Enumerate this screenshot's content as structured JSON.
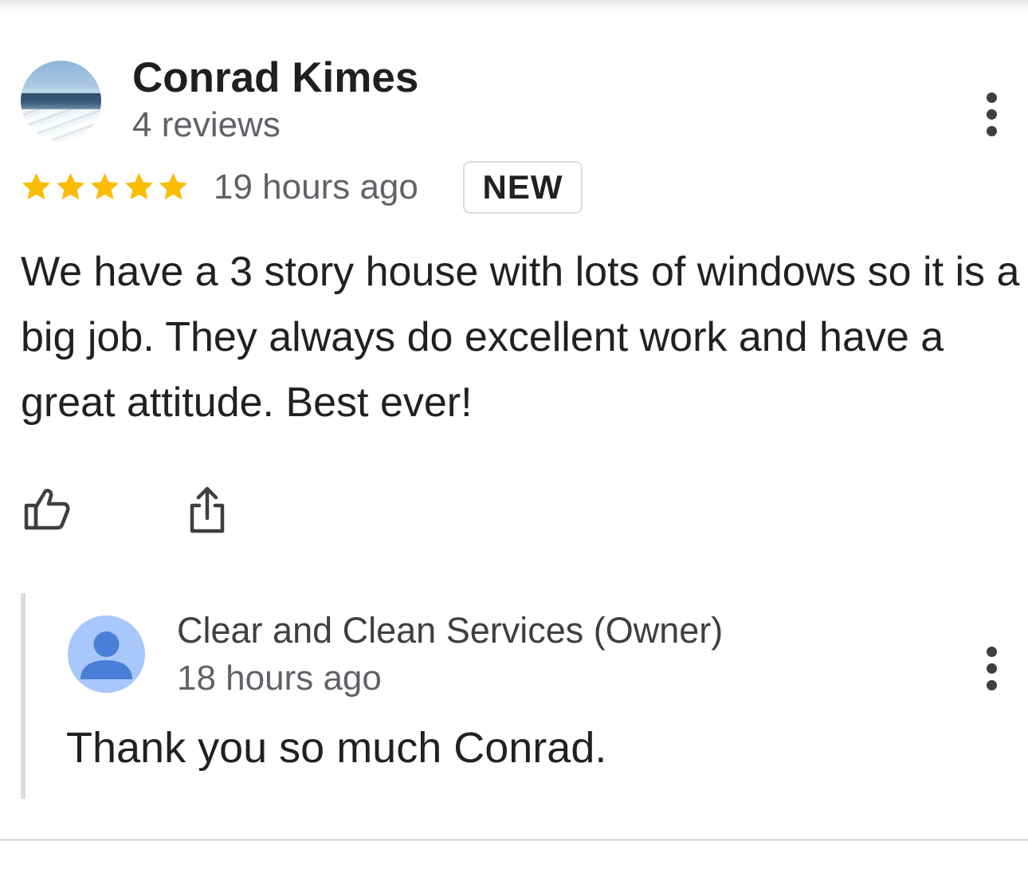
{
  "review": {
    "reviewer_name": "Conrad Kimes",
    "review_count": "4 reviews",
    "rating": 5,
    "rating_max": 5,
    "time_ago": "19 hours ago",
    "badge": "NEW",
    "text": "We have a 3 story house with lots of windows so it is a big job. They always do excellent work and have a great attitude. Best ever!",
    "avatar_icon": "beach-photo-avatar",
    "menu_icon": "more-vert-icon"
  },
  "actions": {
    "like_icon": "thumbs-up-icon",
    "share_icon": "share-icon"
  },
  "reply": {
    "owner_name": "Clear and Clean Services (Owner)",
    "time_ago": "18 hours ago",
    "text": "Thank you so much Conrad.",
    "avatar_icon": "default-person-avatar",
    "menu_icon": "more-vert-icon"
  },
  "colors": {
    "star": "#fbbc04",
    "text_primary": "#202124",
    "text_secondary": "#5f6368",
    "owner_avatar_bg": "#a8c7fa",
    "owner_avatar_fg": "#4a7fd8",
    "divider": "#dadce0"
  }
}
